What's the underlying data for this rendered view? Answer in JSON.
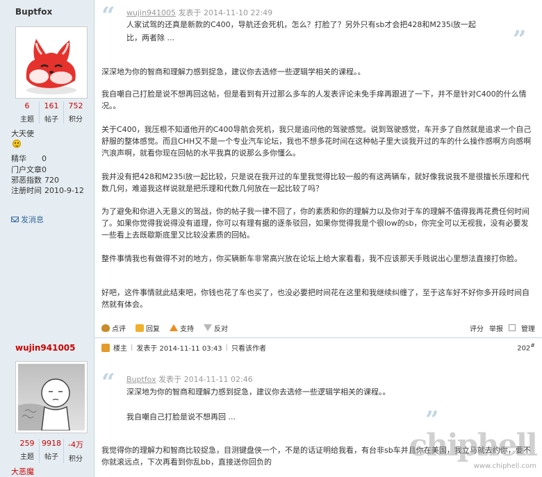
{
  "user1": {
    "name": "Buptfox",
    "stats": [
      {
        "num": "6",
        "label": "主题"
      },
      {
        "num": "161",
        "label": "帖子"
      },
      {
        "num": "752",
        "label": "积分"
      }
    ],
    "title": "大天使",
    "fields": [
      {
        "k": "精华",
        "v": "0"
      },
      {
        "k": "门户文章",
        "v": "0"
      },
      {
        "k": "邪恶指数",
        "v": "720"
      },
      {
        "k": "注册时间",
        "v": "2010-9-12"
      }
    ],
    "send_message": "发消息"
  },
  "user2": {
    "name": "wujin941005",
    "stats": [
      {
        "num": "259",
        "label": "主题"
      },
      {
        "num": "9918",
        "label": "帖子"
      },
      {
        "num": "-4万",
        "label": "积分"
      }
    ],
    "title": "大恶魔"
  },
  "post1": {
    "quote": {
      "author": "wujin941005",
      "posted_text": "发表于 2014-11-10 22:49",
      "line1": "人家试驾的还真是新款的C400，导航还会死机，怎么？打脸了？另外只有sb才会把428和M235i放一起",
      "line2": "比，两者除 ..."
    },
    "paragraphs": [
      "深深地为你的智商和理解力感到捉急，建议你去选修一些逻辑学相关的课程。。",
      "我自嘲自己打脸是说不想再回这帖，但是看到有开过那么多车的人发表评论未免手痒再跟进了一下，并不是针对C400的什么情况。。",
      "关于C400，我压根不知道他开的C400导航会死机，我只是追问他的驾驶感觉。说到驾驶感觉，车开多了自然就是追求一个自己舒服的整体感觉。而且CHH又不是一个专业汽车论坛，我也不想多花时间在这种帖子里大谈我开过的车的什么操作感啊方向感啊汽浪声啊，就看你现在回帖的水平我真的说那么多你懂么。",
      "我并没有把428和M235i放一起比较，只是说在我开过的车里我觉得比较一般的有这两辆车，就好像我说我不是很擅长乐理和代数几何，难道我这样说就是把乐理和代数几何放在一起比较了吗？",
      "为了避免和你进入无意义的驾战，你的帖子我一律不回了，你的素质和你的理解力以及你对于车的理解不值得我再花费任何时间了。如果你觉得我说得没有道理，你可以有理有据的逐条驳回，如果你觉得我是个很low的sb，你完全可以无视我，没有必要发一些看上去既歇斯底里又比较没素质的回帖。",
      "整件事情我也有做得不对的地方，你买辆新车非常高兴放在论坛上给大家看看，我不应该那天手贱说出心里想法直接打你脸。",
      "好吧，这件事情就此结束吧，你钱也花了车也买了，也没必要把时间花在这里和我继续纠缠了，至于这车好不好你多开段时间自然就有体会。"
    ],
    "actions": {
      "rate": "点评",
      "reply": "回复",
      "support": "支持",
      "oppose": "反对",
      "score": "评分",
      "report": "举报",
      "manage": "管理"
    }
  },
  "post2": {
    "head": {
      "badge": "楼主",
      "posted": "发表于 2014-11-11 03:43",
      "only_author": "只看该作者",
      "floor_num": "202",
      "floor_mark": "#"
    },
    "quote": {
      "author": "Buptfox",
      "posted_text": "发表于 2014-11-11 02:46",
      "line1": "深深地为你的智商和理解力感到捉急，建议你去选修一些逻辑学相关的课程。。",
      "line2": "我自嘲自己打脸是说不想再回 ..."
    },
    "paragraph": "我觉得你的理解力和智商比较捉急，目测键盘侠一个，不是的话证明给我看，有台非sb车并且你在美国，我立马就去约你，要不你就滚远点，下次再看到你乱bb，直接送你回负的"
  },
  "watermark": {
    "logo": "chiphell",
    "url": "www.chiphell.com"
  }
}
